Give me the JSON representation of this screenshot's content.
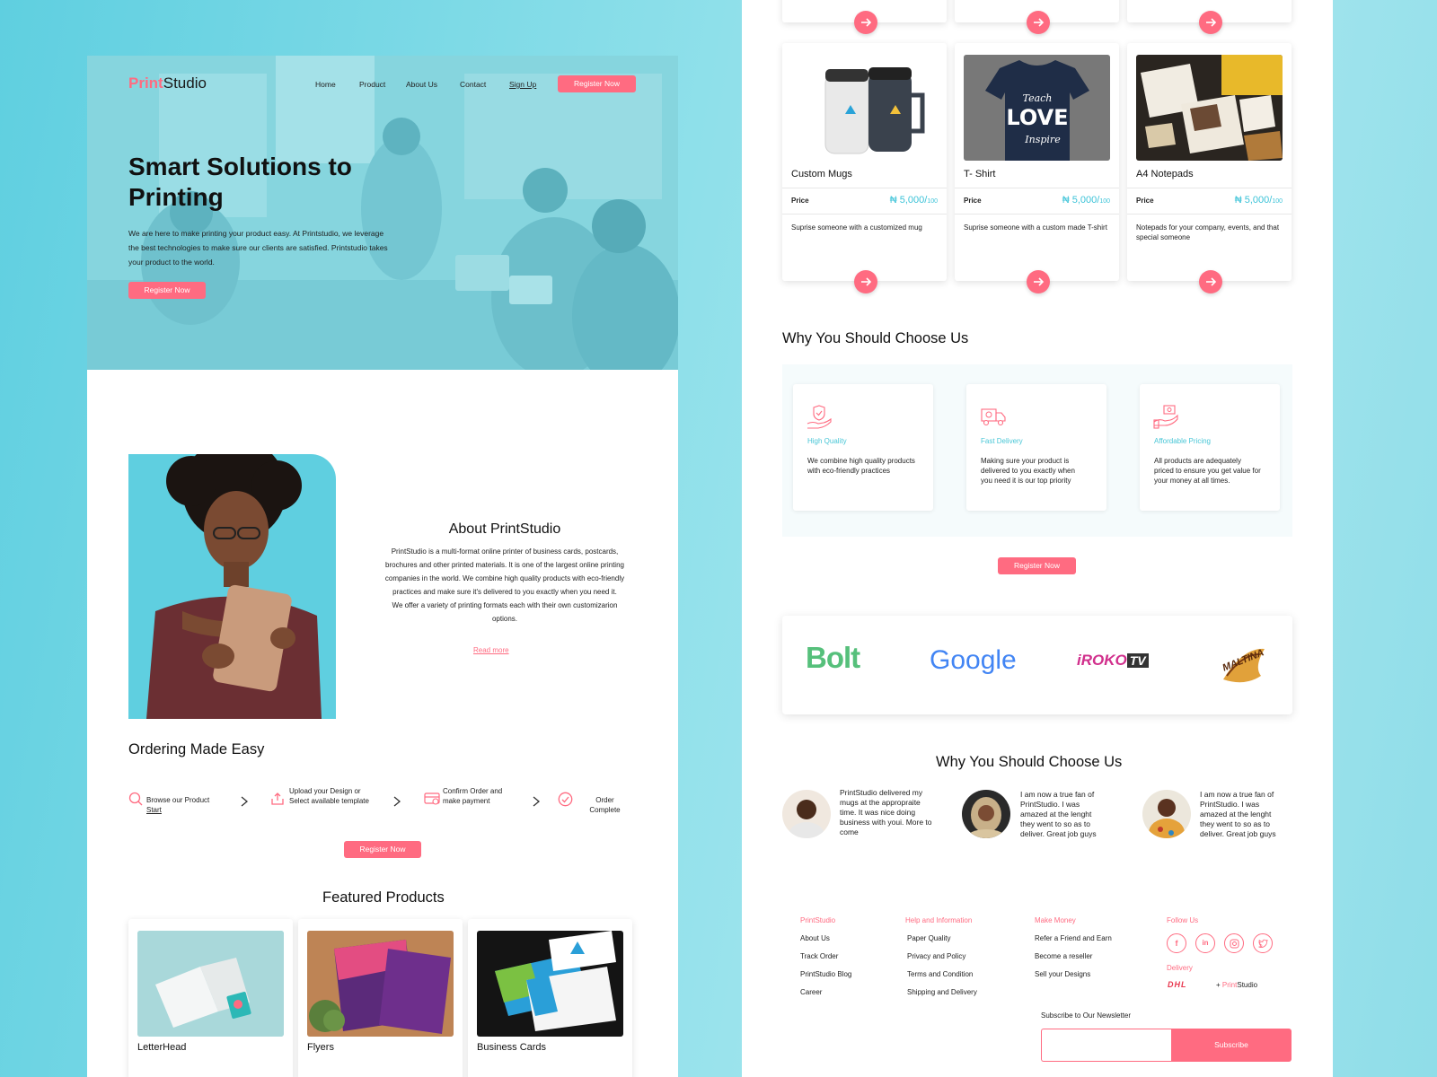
{
  "brand": {
    "part1": "Print",
    "part2": "Studio"
  },
  "nav": {
    "items": [
      "Home",
      "Product",
      "About Us",
      "Contact",
      "Sign Up"
    ],
    "cta": "Register Now"
  },
  "hero": {
    "title": "Smart Solutions to Printing",
    "text": "We are here to make printing your product easy. At Printstudio, we leverage the best technologies to make sure our clients are satisfied. Printstudio takes your product to the world.",
    "cta": "Register Now"
  },
  "about": {
    "title": "About PrintStudio",
    "text": "PrintStudio is a multi-format online printer of business cards, postcards, brochures and other printed materials. It is one of the largest online printing companies in the world. We combine high quality products with eco-friendly practices and make sure it's delivered to you exactly when you need it.\nWe offer a variety of printing formats each with their own customizarion options.",
    "read_more": "Read more"
  },
  "ordering": {
    "title": "Ordering Made Easy",
    "steps": [
      {
        "label": "Browse our Product",
        "sub": "Start",
        "icon": "search-icon"
      },
      {
        "label": "Upload your Design or Select available template",
        "icon": "upload-icon"
      },
      {
        "label": "Confirm Order and make payment",
        "icon": "payment-card-icon"
      },
      {
        "label": "Order Complete",
        "icon": "check-circle-icon"
      }
    ],
    "cta": "Register Now"
  },
  "featured": {
    "title": "Featured Products",
    "items": [
      "LetterHead",
      "Flyers",
      "Business Cards"
    ]
  },
  "products": [
    {
      "name": "Custom Mugs",
      "price_label": "Price",
      "price": "₦ 5,000/",
      "unit": "100",
      "desc": "Suprise someone with a customized mug"
    },
    {
      "name": "T- Shirt",
      "price_label": "Price",
      "price": "₦ 5,000/",
      "unit": "100",
      "desc": "Suprise someone with a custom made T-shirt"
    },
    {
      "name": "A4 Notepads",
      "price_label": "Price",
      "price": "₦ 5,000/",
      "unit": "100",
      "desc": "Notepads for your company, events, and that special someone"
    }
  ],
  "tshirt_print": {
    "line1": "Teach",
    "line2": "LOVE",
    "line3": "Inspire"
  },
  "why": {
    "title": "Why You Should Choose Us",
    "cards": [
      {
        "title": "High Quality",
        "text": "We combine high quality products with eco-friendly practices",
        "icon": "quality-hand-icon"
      },
      {
        "title": "Fast Delivery",
        "text": "Making sure your product is delivered to you exactly when you need it is our top priority",
        "icon": "delivery-truck-icon"
      },
      {
        "title": "Affordable Pricing",
        "text": "All products are adequately priced to ensure you get value for your money at all times.",
        "icon": "price-hand-icon"
      }
    ],
    "cta": "Register Now"
  },
  "partners": [
    "Bolt",
    "Google",
    "iROKOtv",
    "MALTINA"
  ],
  "iroko": {
    "main": "iROKO",
    "tv": "TV"
  },
  "testimonials": {
    "title": "Why You Should Choose Us",
    "items": [
      "PrintStudio delivered my mugs at the appropraite time. It was nice doing business with youi. More to come",
      "I am now a true fan of PrintStudio. I was amazed at the lenght they went to so as to deliver. Great job guys",
      "I am now a true fan of PrintStudio. I was amazed at the lenght they went to so as to deliver. Great job guys"
    ]
  },
  "footer": {
    "col1": {
      "head": "PrintStudio",
      "links": [
        "About Us",
        "Track Order",
        "PrintStudio Blog",
        "Career"
      ]
    },
    "col2": {
      "head": "Help and Information",
      "links": [
        "Paper Quality",
        "Privacy and Policy",
        "Terms and Condition",
        "Shipping and Delivery"
      ]
    },
    "col3": {
      "head": "Make Money",
      "links": [
        "Refer a Friend and Earn",
        "Become a reseller",
        "Sell your Designs"
      ]
    },
    "follow": {
      "head": "Follow Us",
      "icons": [
        "facebook-icon",
        "linkedin-icon",
        "instagram-icon",
        "twitter-icon"
      ]
    },
    "delivery": {
      "head": "Delivery",
      "dhl": "DHL",
      "plus": "+ ",
      "brand1": "Print",
      "brand2": "Studio"
    },
    "newsletter": {
      "label": "Subscribe to Our Newsletter",
      "placeholder": "",
      "button": "Subscribe"
    }
  },
  "colors": {
    "accent": "#ff6b81",
    "teal": "#5fcfe0",
    "teal_text": "#3cc3d8"
  }
}
